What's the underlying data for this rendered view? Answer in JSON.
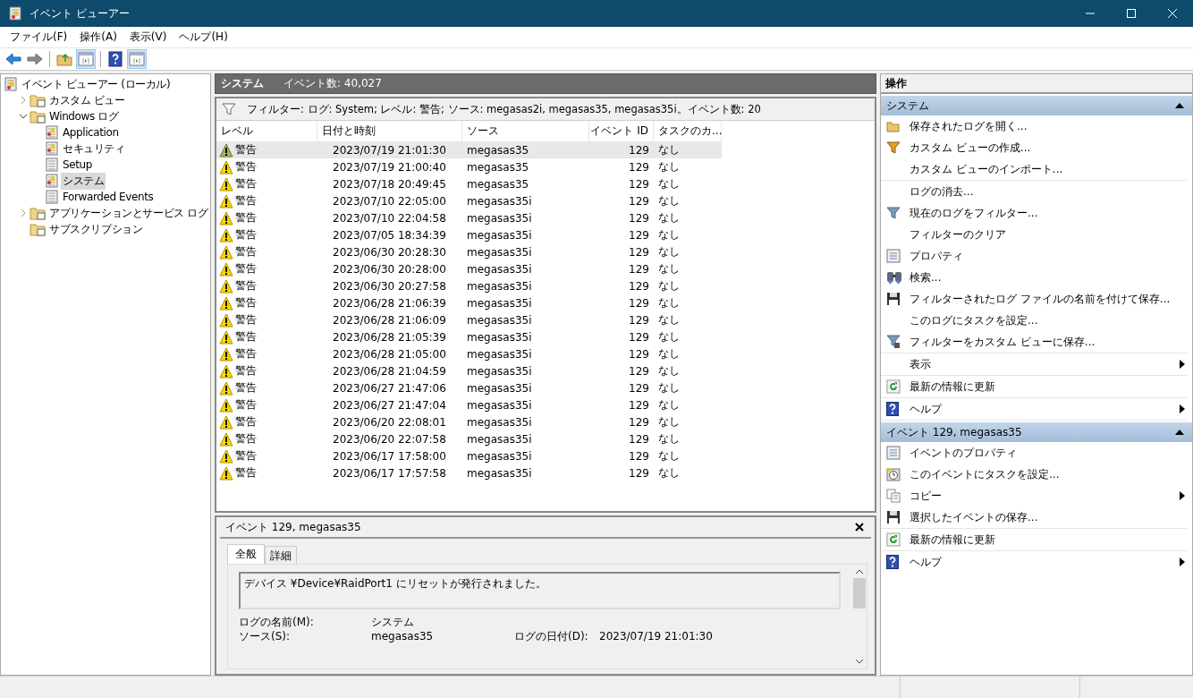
{
  "window": {
    "title": "イベント ビューアー"
  },
  "menu": [
    "ファイル(F)",
    "操作(A)",
    "表示(V)",
    "ヘルプ(H)"
  ],
  "toolbar": [
    {
      "pressed": false
    },
    {
      "pressed": false
    },
    {
      "pressed": false
    },
    {
      "pressed": true
    },
    {
      "pressed": false
    },
    {
      "pressed": true
    }
  ],
  "tree": [
    {
      "label": "イベント ビューアー (ローカル)",
      "kind": "root",
      "selected": false,
      "children": [
        {
          "label": "カスタム ビュー",
          "kind": "folder",
          "expanded": false,
          "selected": false
        },
        {
          "label": "Windows ログ",
          "kind": "folder",
          "expanded": true,
          "selected": false,
          "children": [
            {
              "label": "Application",
              "kind": "eventlog",
              "selected": false
            },
            {
              "label": "セキュリティ",
              "kind": "eventlog",
              "selected": false
            },
            {
              "label": "Setup",
              "kind": "log",
              "selected": false
            },
            {
              "label": "システム",
              "kind": "eventlog",
              "selected": true
            },
            {
              "label": "Forwarded Events",
              "kind": "log",
              "selected": false
            }
          ]
        },
        {
          "label": "アプリケーションとサービス ログ",
          "kind": "folder",
          "expanded": false,
          "selected": false
        },
        {
          "label": "サブスクリプション",
          "kind": "folder",
          "selected": false
        }
      ]
    }
  ],
  "center": {
    "title": "システム",
    "count": "イベント数: 40,027",
    "filter": "フィルター: ログ: System; レベル: 警告; ソース: megasas2i, megasas35, megasas35i。イベント数: 20"
  },
  "table": {
    "columns": [
      "レベル",
      "日付と時刻",
      "ソース",
      "イベント ID",
      "タスクのカ..."
    ],
    "rows": [
      {
        "level": "警告",
        "date": "2023/07/19 21:01:30",
        "source": "megasas35",
        "id": "129",
        "task": "なし",
        "selected": true
      },
      {
        "level": "警告",
        "date": "2023/07/19 21:00:40",
        "source": "megasas35",
        "id": "129",
        "task": "なし",
        "selected": false
      },
      {
        "level": "警告",
        "date": "2023/07/18 20:49:45",
        "source": "megasas35",
        "id": "129",
        "task": "なし",
        "selected": false
      },
      {
        "level": "警告",
        "date": "2023/07/10 22:05:00",
        "source": "megasas35i",
        "id": "129",
        "task": "なし",
        "selected": false
      },
      {
        "level": "警告",
        "date": "2023/07/10 22:04:58",
        "source": "megasas35i",
        "id": "129",
        "task": "なし",
        "selected": false
      },
      {
        "level": "警告",
        "date": "2023/07/05 18:34:39",
        "source": "megasas35i",
        "id": "129",
        "task": "なし",
        "selected": false
      },
      {
        "level": "警告",
        "date": "2023/06/30 20:28:30",
        "source": "megasas35i",
        "id": "129",
        "task": "なし",
        "selected": false
      },
      {
        "level": "警告",
        "date": "2023/06/30 20:28:00",
        "source": "megasas35i",
        "id": "129",
        "task": "なし",
        "selected": false
      },
      {
        "level": "警告",
        "date": "2023/06/30 20:27:58",
        "source": "megasas35i",
        "id": "129",
        "task": "なし",
        "selected": false
      },
      {
        "level": "警告",
        "date": "2023/06/28 21:06:39",
        "source": "megasas35i",
        "id": "129",
        "task": "なし",
        "selected": false
      },
      {
        "level": "警告",
        "date": "2023/06/28 21:06:09",
        "source": "megasas35i",
        "id": "129",
        "task": "なし",
        "selected": false
      },
      {
        "level": "警告",
        "date": "2023/06/28 21:05:39",
        "source": "megasas35i",
        "id": "129",
        "task": "なし",
        "selected": false
      },
      {
        "level": "警告",
        "date": "2023/06/28 21:05:00",
        "source": "megasas35i",
        "id": "129",
        "task": "なし",
        "selected": false
      },
      {
        "level": "警告",
        "date": "2023/06/28 21:04:59",
        "source": "megasas35i",
        "id": "129",
        "task": "なし",
        "selected": false
      },
      {
        "level": "警告",
        "date": "2023/06/27 21:47:06",
        "source": "megasas35i",
        "id": "129",
        "task": "なし",
        "selected": false
      },
      {
        "level": "警告",
        "date": "2023/06/27 21:47:04",
        "source": "megasas35i",
        "id": "129",
        "task": "なし",
        "selected": false
      },
      {
        "level": "警告",
        "date": "2023/06/20 22:08:01",
        "source": "megasas35i",
        "id": "129",
        "task": "なし",
        "selected": false
      },
      {
        "level": "警告",
        "date": "2023/06/20 22:07:58",
        "source": "megasas35i",
        "id": "129",
        "task": "なし",
        "selected": false
      },
      {
        "level": "警告",
        "date": "2023/06/17 17:58:00",
        "source": "megasas35i",
        "id": "129",
        "task": "なし",
        "selected": false
      },
      {
        "level": "警告",
        "date": "2023/06/17 17:57:58",
        "source": "megasas35i",
        "id": "129",
        "task": "なし",
        "selected": false
      }
    ]
  },
  "detail": {
    "title": "イベント 129, megasas35",
    "tabs": [
      {
        "label": "全般",
        "selected": true
      },
      {
        "label": "詳細",
        "selected": false
      }
    ],
    "message": "デバイス ¥Device¥RaidPort1 にリセットが発行されました。",
    "fields": [
      {
        "label": "ログの名前(M):",
        "value": "システム"
      },
      {
        "label": "ソース(S):",
        "value": "megasas35",
        "label_2": "ログの日付(D):",
        "value_2": "2023/07/19 21:01:30"
      }
    ]
  },
  "actions": {
    "title": "操作",
    "sections": [
      {
        "title": "システム",
        "expanded": true,
        "groups": [
          [
            {
              "label": "保存されたログを開く..."
            },
            {
              "label": "カスタム ビューの作成..."
            },
            {
              "label": "カスタム ビューのインポート..."
            }
          ],
          [
            {
              "label": "ログの消去..."
            },
            {
              "label": "現在のログをフィルター..."
            },
            {
              "label": "フィルターのクリア"
            },
            {
              "label": "プロパティ"
            },
            {
              "label": "検索..."
            },
            {
              "label": "フィルターされたログ ファイルの名前を付けて保存..."
            },
            {
              "label": "このログにタスクを設定..."
            },
            {
              "label": "フィルターをカスタム ビューに保存..."
            }
          ],
          [
            {
              "label": "表示",
              "submenu": true
            }
          ],
          [
            {
              "label": "最新の情報に更新"
            }
          ],
          [
            {
              "label": "ヘルプ",
              "submenu": true
            }
          ]
        ]
      },
      {
        "title": "イベント 129, megasas35",
        "expanded": true,
        "groups": [
          [
            {
              "label": "イベントのプロパティ"
            },
            {
              "label": "このイベントにタスクを設定..."
            },
            {
              "label": "コピー",
              "submenu": true
            },
            {
              "label": "選択したイベントの保存..."
            }
          ],
          [
            {
              "label": "最新の情報に更新"
            }
          ],
          [
            {
              "label": "ヘルプ",
              "submenu": true
            }
          ]
        ]
      }
    ]
  }
}
